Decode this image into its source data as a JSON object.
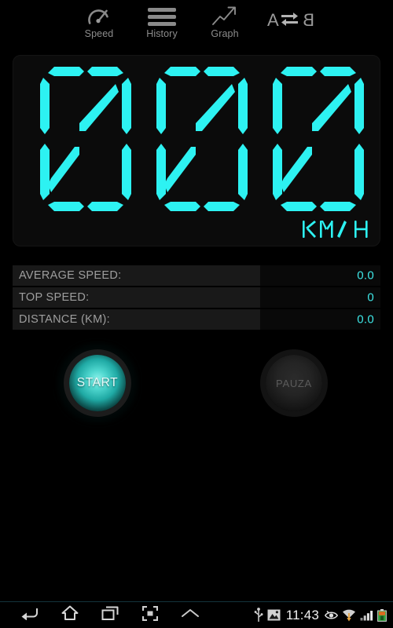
{
  "app": {
    "accent_cyan": "#2df2f2",
    "background": "#000000",
    "panel_background": "#0b0b0b"
  },
  "toolbar": {
    "items": [
      {
        "label": "Speed",
        "icon": "speedometer-gauge-icon"
      },
      {
        "label": "History",
        "icon": "hamburger-list-icon"
      },
      {
        "label": "Graph",
        "icon": "trending-up-arrow-icon"
      }
    ],
    "unit_swap": {
      "from": "A",
      "to": "B",
      "icon": "swap-arrows-icon"
    }
  },
  "speedometer": {
    "digits": [
      "0",
      "0",
      "0"
    ],
    "value": "000",
    "unit": "KM/H",
    "segment_color": "#2df2f2"
  },
  "stats": {
    "rows": [
      {
        "label": "AVERAGE SPEED:",
        "value": "0.0"
      },
      {
        "label": "TOP SPEED:",
        "value": "0"
      },
      {
        "label": "DISTANCE (KM):",
        "value": "0.0"
      }
    ]
  },
  "controls": {
    "start": {
      "label": "START",
      "state": "enabled"
    },
    "pause": {
      "label": "PAUZA",
      "state": "disabled"
    }
  },
  "system_bar": {
    "nav": [
      {
        "name": "back",
        "icon": "back-arrow-icon"
      },
      {
        "name": "home",
        "icon": "home-icon"
      },
      {
        "name": "recents",
        "icon": "recent-apps-icon"
      },
      {
        "name": "screenshot",
        "icon": "screenshot-crop-icon"
      },
      {
        "name": "expand",
        "icon": "chevron-up-icon"
      }
    ],
    "clock": "11:43",
    "status_icons": [
      "usb-icon",
      "screenshot-image-icon",
      "eye-icon",
      "wifi-download-icon",
      "signal-bars-icon",
      "battery-icon"
    ]
  }
}
